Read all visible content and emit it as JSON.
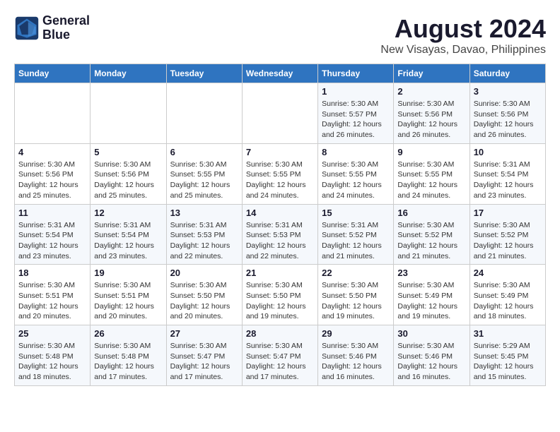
{
  "header": {
    "logo_line1": "General",
    "logo_line2": "Blue",
    "month_year": "August 2024",
    "location": "New Visayas, Davao, Philippines"
  },
  "weekdays": [
    "Sunday",
    "Monday",
    "Tuesday",
    "Wednesday",
    "Thursday",
    "Friday",
    "Saturday"
  ],
  "weeks": [
    [
      {
        "day": "",
        "info": ""
      },
      {
        "day": "",
        "info": ""
      },
      {
        "day": "",
        "info": ""
      },
      {
        "day": "",
        "info": ""
      },
      {
        "day": "1",
        "info": "Sunrise: 5:30 AM\nSunset: 5:57 PM\nDaylight: 12 hours\nand 26 minutes."
      },
      {
        "day": "2",
        "info": "Sunrise: 5:30 AM\nSunset: 5:56 PM\nDaylight: 12 hours\nand 26 minutes."
      },
      {
        "day": "3",
        "info": "Sunrise: 5:30 AM\nSunset: 5:56 PM\nDaylight: 12 hours\nand 26 minutes."
      }
    ],
    [
      {
        "day": "4",
        "info": "Sunrise: 5:30 AM\nSunset: 5:56 PM\nDaylight: 12 hours\nand 25 minutes."
      },
      {
        "day": "5",
        "info": "Sunrise: 5:30 AM\nSunset: 5:56 PM\nDaylight: 12 hours\nand 25 minutes."
      },
      {
        "day": "6",
        "info": "Sunrise: 5:30 AM\nSunset: 5:55 PM\nDaylight: 12 hours\nand 25 minutes."
      },
      {
        "day": "7",
        "info": "Sunrise: 5:30 AM\nSunset: 5:55 PM\nDaylight: 12 hours\nand 24 minutes."
      },
      {
        "day": "8",
        "info": "Sunrise: 5:30 AM\nSunset: 5:55 PM\nDaylight: 12 hours\nand 24 minutes."
      },
      {
        "day": "9",
        "info": "Sunrise: 5:30 AM\nSunset: 5:55 PM\nDaylight: 12 hours\nand 24 minutes."
      },
      {
        "day": "10",
        "info": "Sunrise: 5:31 AM\nSunset: 5:54 PM\nDaylight: 12 hours\nand 23 minutes."
      }
    ],
    [
      {
        "day": "11",
        "info": "Sunrise: 5:31 AM\nSunset: 5:54 PM\nDaylight: 12 hours\nand 23 minutes."
      },
      {
        "day": "12",
        "info": "Sunrise: 5:31 AM\nSunset: 5:54 PM\nDaylight: 12 hours\nand 23 minutes."
      },
      {
        "day": "13",
        "info": "Sunrise: 5:31 AM\nSunset: 5:53 PM\nDaylight: 12 hours\nand 22 minutes."
      },
      {
        "day": "14",
        "info": "Sunrise: 5:31 AM\nSunset: 5:53 PM\nDaylight: 12 hours\nand 22 minutes."
      },
      {
        "day": "15",
        "info": "Sunrise: 5:31 AM\nSunset: 5:52 PM\nDaylight: 12 hours\nand 21 minutes."
      },
      {
        "day": "16",
        "info": "Sunrise: 5:30 AM\nSunset: 5:52 PM\nDaylight: 12 hours\nand 21 minutes."
      },
      {
        "day": "17",
        "info": "Sunrise: 5:30 AM\nSunset: 5:52 PM\nDaylight: 12 hours\nand 21 minutes."
      }
    ],
    [
      {
        "day": "18",
        "info": "Sunrise: 5:30 AM\nSunset: 5:51 PM\nDaylight: 12 hours\nand 20 minutes."
      },
      {
        "day": "19",
        "info": "Sunrise: 5:30 AM\nSunset: 5:51 PM\nDaylight: 12 hours\nand 20 minutes."
      },
      {
        "day": "20",
        "info": "Sunrise: 5:30 AM\nSunset: 5:50 PM\nDaylight: 12 hours\nand 20 minutes."
      },
      {
        "day": "21",
        "info": "Sunrise: 5:30 AM\nSunset: 5:50 PM\nDaylight: 12 hours\nand 19 minutes."
      },
      {
        "day": "22",
        "info": "Sunrise: 5:30 AM\nSunset: 5:50 PM\nDaylight: 12 hours\nand 19 minutes."
      },
      {
        "day": "23",
        "info": "Sunrise: 5:30 AM\nSunset: 5:49 PM\nDaylight: 12 hours\nand 19 minutes."
      },
      {
        "day": "24",
        "info": "Sunrise: 5:30 AM\nSunset: 5:49 PM\nDaylight: 12 hours\nand 18 minutes."
      }
    ],
    [
      {
        "day": "25",
        "info": "Sunrise: 5:30 AM\nSunset: 5:48 PM\nDaylight: 12 hours\nand 18 minutes."
      },
      {
        "day": "26",
        "info": "Sunrise: 5:30 AM\nSunset: 5:48 PM\nDaylight: 12 hours\nand 17 minutes."
      },
      {
        "day": "27",
        "info": "Sunrise: 5:30 AM\nSunset: 5:47 PM\nDaylight: 12 hours\nand 17 minutes."
      },
      {
        "day": "28",
        "info": "Sunrise: 5:30 AM\nSunset: 5:47 PM\nDaylight: 12 hours\nand 17 minutes."
      },
      {
        "day": "29",
        "info": "Sunrise: 5:30 AM\nSunset: 5:46 PM\nDaylight: 12 hours\nand 16 minutes."
      },
      {
        "day": "30",
        "info": "Sunrise: 5:30 AM\nSunset: 5:46 PM\nDaylight: 12 hours\nand 16 minutes."
      },
      {
        "day": "31",
        "info": "Sunrise: 5:29 AM\nSunset: 5:45 PM\nDaylight: 12 hours\nand 15 minutes."
      }
    ]
  ]
}
